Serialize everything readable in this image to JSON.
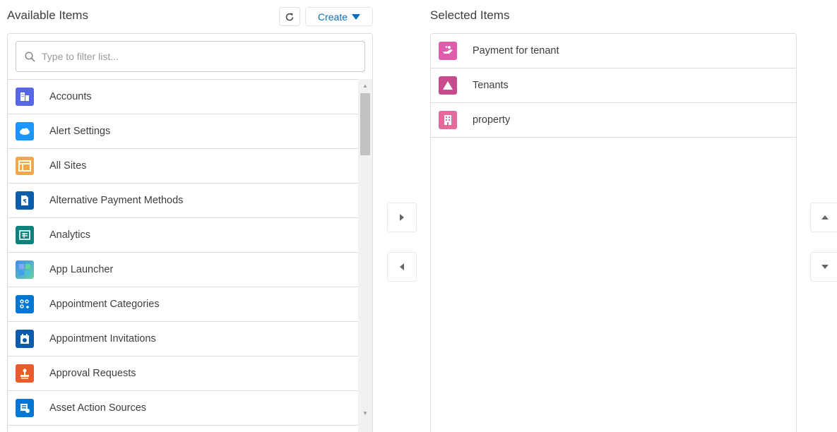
{
  "available": {
    "heading": "Available Items",
    "create_label": "Create",
    "search_placeholder": "Type to filter list...",
    "items": [
      {
        "label": "Accounts",
        "icon": "accounts-icon",
        "color": "#5867e8"
      },
      {
        "label": "Alert Settings",
        "icon": "cloud-icon",
        "color": "#1b96ff"
      },
      {
        "label": "All Sites",
        "icon": "sites-icon",
        "color": "#f4a746"
      },
      {
        "label": "Alternative Payment Methods",
        "icon": "payment-method-icon",
        "color": "#0b5cab"
      },
      {
        "label": "Analytics",
        "icon": "analytics-icon",
        "color": "#0b827c"
      },
      {
        "label": "App Launcher",
        "icon": "app-launcher-icon",
        "color": "#3d8df5"
      },
      {
        "label": "Appointment Categories",
        "icon": "appointment-categories-icon",
        "color": "#0176d3"
      },
      {
        "label": "Appointment Invitations",
        "icon": "calendar-icon",
        "color": "#0b5cab"
      },
      {
        "label": "Approval Requests",
        "icon": "approval-icon",
        "color": "#ea5c2b"
      },
      {
        "label": "Asset Action Sources",
        "icon": "asset-action-icon",
        "color": "#0176d3"
      }
    ]
  },
  "selected": {
    "heading": "Selected Items",
    "items": [
      {
        "label": "Payment for tenant",
        "icon": "hand-icon",
        "color": "#e05cac"
      },
      {
        "label": "Tenants",
        "icon": "triangle-icon",
        "color": "#c84b8e"
      },
      {
        "label": "property",
        "icon": "building-icon",
        "color": "#e46a9c"
      }
    ]
  }
}
